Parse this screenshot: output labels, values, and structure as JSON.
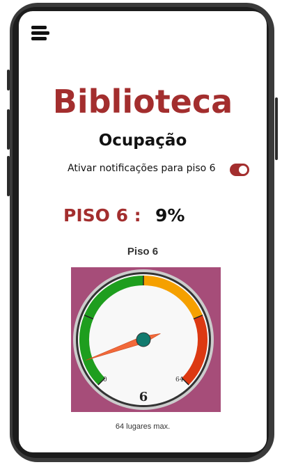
{
  "app": {
    "title": "Biblioteca",
    "subtitle": "Ocupação"
  },
  "notifications": {
    "label": "Ativar notificações para piso 6",
    "enabled": true
  },
  "occupancy": {
    "floor_label": "PISO 6 :",
    "percent_text": "9%"
  },
  "gauge": {
    "title": "Piso 6",
    "min": 0,
    "max": 64,
    "min_label": "0",
    "max_label": "64",
    "value": 6,
    "value_label": "6",
    "footer": "64 lugares max.",
    "colors": {
      "background": "#a64d79",
      "green": "#1e9e1e",
      "orange": "#f5a000",
      "red": "#dc3912",
      "needle": "#f2693a",
      "hub": "#117a6e"
    }
  }
}
